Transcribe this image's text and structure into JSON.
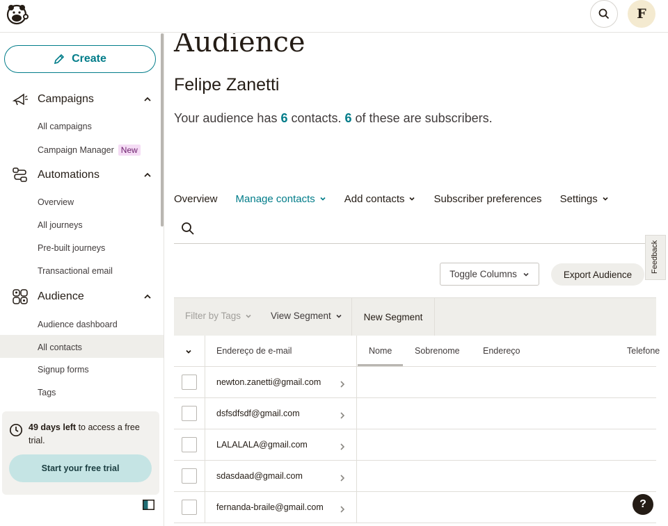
{
  "nav": {
    "create_label": "Create",
    "campaigns": {
      "label": "Campaigns",
      "items": [
        "All campaigns",
        "Campaign Manager"
      ],
      "badge": "New"
    },
    "automations": {
      "label": "Automations",
      "items": [
        "Overview",
        "All journeys",
        "Pre-built journeys",
        "Transactional email"
      ]
    },
    "audience": {
      "label": "Audience",
      "items": [
        "Audience dashboard",
        "All contacts",
        "Signup forms",
        "Tags"
      ],
      "active": "All contacts"
    }
  },
  "trial": {
    "days_left": "49 days left",
    "text": " to access a free trial.",
    "button": "Start your free trial"
  },
  "main": {
    "title": "Audience",
    "audience_name": "Felipe Zanetti",
    "stats": {
      "prefix": "Your audience has ",
      "contacts": "6",
      "mid": " contacts. ",
      "subscribers": "6",
      "suffix": " of these are subscribers."
    },
    "tabs": [
      {
        "label": "Overview",
        "dropdown": false
      },
      {
        "label": "Manage contacts",
        "dropdown": true,
        "active": true
      },
      {
        "label": "Add contacts",
        "dropdown": true
      },
      {
        "label": "Subscriber preferences",
        "dropdown": false
      },
      {
        "label": "Settings",
        "dropdown": true
      }
    ],
    "toggle_columns": "Toggle Columns",
    "export": "Export Audience",
    "filter_tags": "Filter by Tags",
    "view_segment": "View Segment",
    "new_segment": "New Segment",
    "columns": [
      "Endereço de e-mail",
      "Nome",
      "Sobrenome",
      "Endereço",
      "Telefone"
    ],
    "rows": [
      "newton.zanetti@gmail.com",
      "dsfsdfsdf@gmail.com",
      "LALALALA@gmail.com",
      "sdasdaad@gmail.com",
      "fernanda-braile@gmail.com"
    ]
  },
  "feedback": "Feedback",
  "help": "?",
  "avatar_letter": "F",
  "colors": {
    "accent": "#007c89",
    "badge_new": "#f5dcf5",
    "trial_button": "#c5e4e4"
  }
}
